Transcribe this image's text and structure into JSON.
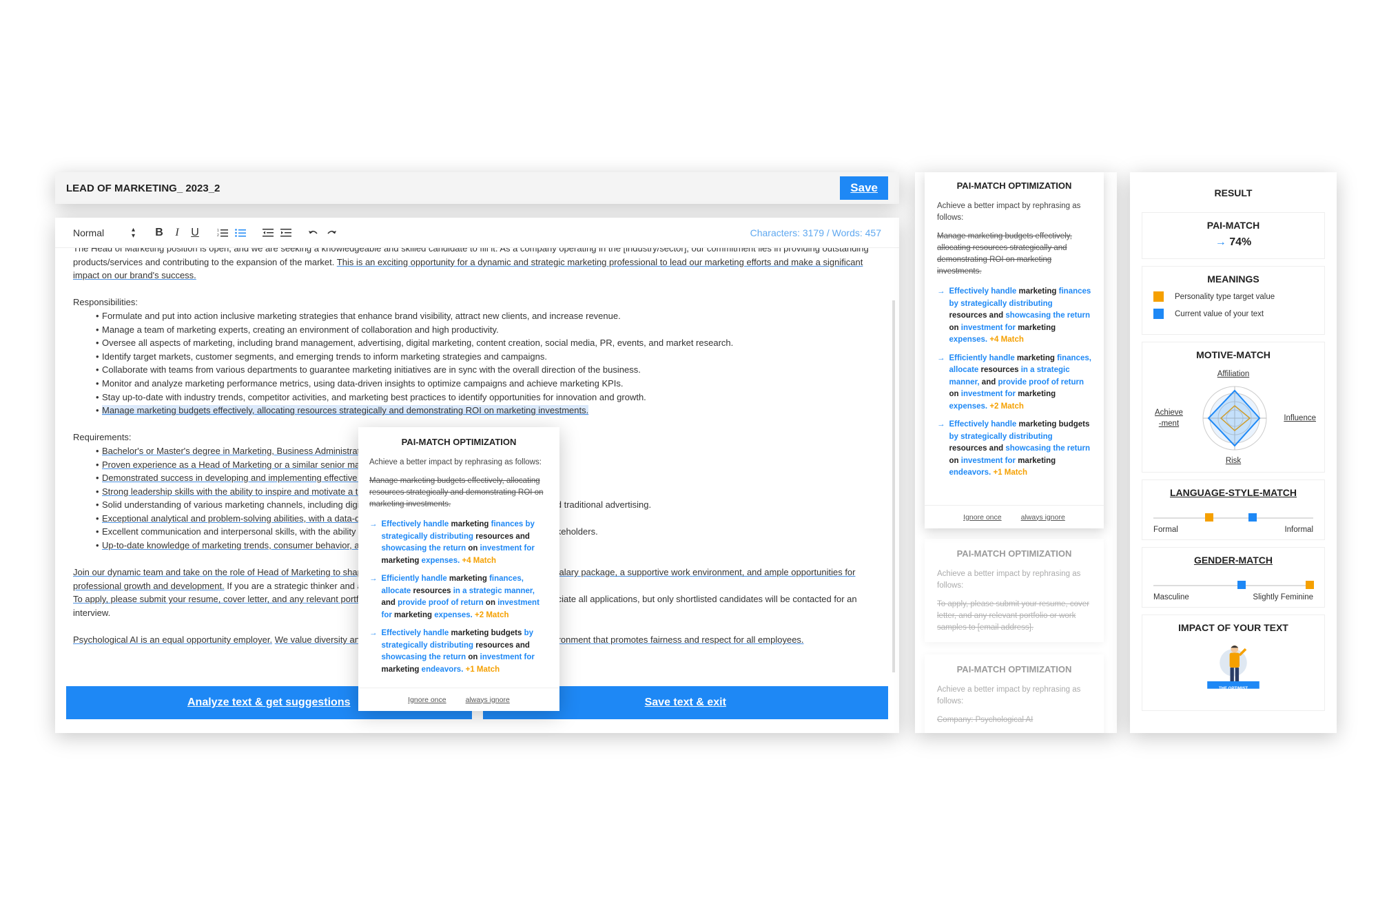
{
  "document": {
    "title": "LEAD OF MARKETING_ 2023_2",
    "save_label": "Save"
  },
  "toolbar": {
    "style": "Normal",
    "stats": "Characters: 3179 / Words: 457"
  },
  "editor": {
    "intro_1": "The Head of Marketing position is open, and we are seeking a knowledgeable and skilled candidate to fill it. As a company operating in the [industry/sector], our commitment lies in providing outstanding products/services and contributing to the expansion of the market.",
    "intro_2": "This is an exciting opportunity for a dynamic and strategic marketing professional to lead our marketing efforts and make a significant impact on our brand's success.",
    "resp_heading": "Responsibilities:",
    "responsibilities": [
      "Formulate and put into action inclusive marketing strategies that enhance brand visibility, attract new clients, and increase revenue.",
      "Manage a team of marketing experts, creating an environment of collaboration and high productivity.",
      "Oversee all aspects of marketing, including brand management, advertising, digital marketing, content creation, social media, PR, events, and market research.",
      "Identify target markets, customer segments, and emerging trends to inform marketing strategies and campaigns.",
      "Collaborate with teams from various departments to guarantee marketing initiatives are in sync with the overall direction of the business.",
      "Monitor and analyze marketing performance metrics, using data-driven insights to optimize campaigns and achieve marketing KPIs.",
      "Stay up-to-date with industry trends, competitor activities, and marketing best practices to identify opportunities for innovation and growth.",
      "Manage marketing budgets effectively, allocating resources strategically and demonstrating ROI on marketing investments."
    ],
    "req_heading": "Requirements:",
    "requirements": [
      "Bachelor's or Master's degree in Marketing, Business Administration, or a related field.",
      "Proven experience as a Head of Marketing or a similar senior marketing role.",
      "Demonstrated success in developing and implementing effective marketing strategies that drive business growth.",
      "Strong leadership skills with the ability to inspire and motivate a team to achieve common goals.",
      "Solid understanding of various marketing channels, including digital marketing, social media, content marketing, and traditional advertising.",
      "Exceptional analytical and problem-solving abilities, with a data-driven mindset.",
      "Excellent communication and interpersonal skills, with the ability to build relationships with internal and external stakeholders.",
      "Up-to-date knowledge of marketing trends, consumer behavior, and emerging technologies."
    ],
    "closing_1a": "Join our dynamic team and take on the role of Head of Marketing to shape the future of our brand. We offer a competitive salary package, a supportive work environment, and ample opportunities for professional growth and development.",
    "closing_1b": "If you are a strategic thinker and a natural leader, we would love to hear from you.",
    "closing_2a": "To apply, please submit your resume, cover letter, and any relevant portfolio or work samples to [email address].",
    "closing_2b": "We appreciate all applications, but only shortlisted candidates will be contacted for an interview.",
    "closing_3a": "Psychological AI is an equal opportunity employer.",
    "closing_3b": "We value diversity and are committed to creating an inclusive work environment that promotes fairness and respect for all employees."
  },
  "actions": {
    "analyze": "Analyze text & get suggestions",
    "save_exit": "Save text & exit"
  },
  "popup": {
    "heading": "PAI-MATCH OPTIMIZATION",
    "intro": "Achieve a better impact by rephrasing as follows:",
    "original": "Manage marketing budgets effectively, allocating resources strategically and demonstrating ROI on marketing investments.",
    "ignore_once": "Ignore once",
    "always_ignore": "always ignore"
  },
  "suggestions": [
    {
      "p1": "Effectively handle",
      "p2": " marketing ",
      "p3": "finances by strategically distributing",
      "p4": " resources and ",
      "p5": "showcasing the return",
      "p6": " on ",
      "p7": "investment for",
      "p8": " marketing ",
      "p9": "expenses.",
      "match": "+4 Match"
    },
    {
      "p1": "Efficiently handle",
      "p2": " marketing ",
      "p3": "finances, allocate",
      "p4": " resources ",
      "p5": "in a strategic manner,",
      "p6": " and ",
      "p7": "provide proof of return",
      "p8": " on ",
      "p9": "investment for",
      "p10": " marketing ",
      "p11": "expenses.",
      "match": "+2 Match"
    },
    {
      "p1": "Effectively handle",
      "p2": " marketing budgets ",
      "p3": "by strategically distributing",
      "p4": " resources and ",
      "p5": "showcasing the return",
      "p6": " on ",
      "p7": "investment for",
      "p8": " marketing ",
      "p9": "endeavors.",
      "match": "+1 Match"
    }
  ],
  "side_cards": [
    {
      "heading": "PAI-MATCH OPTIMIZATION",
      "intro": "Achieve a better impact by rephrasing as follows:",
      "original": "To apply, please submit your resume, cover letter, and any relevant portfolio or work samples to [email address]."
    },
    {
      "heading": "PAI-MATCH OPTIMIZATION",
      "intro": "Achieve a better impact by rephrasing as follows:",
      "original": "Company: Psychological AI"
    }
  ],
  "result": {
    "title": "RESULT",
    "pai_match": {
      "label": "PAI-MATCH",
      "value": "74%"
    },
    "meanings": {
      "label": "MEANINGS",
      "target": "Personality type target value",
      "current": "Current value of your text"
    },
    "motive": {
      "label": "MOTIVE-MATCH",
      "affiliation": "Affiliation",
      "achievement_1": "Achieve",
      "achievement_2": "-ment",
      "influence": "Influence",
      "risk": "Risk"
    },
    "language": {
      "label": "LANGUAGE-STYLE-MATCH",
      "left": "Formal",
      "right": "Informal",
      "target": 0.35,
      "current": 0.62
    },
    "gender": {
      "label": "GENDER-MATCH",
      "left": "Masculine",
      "right": "Slightly Feminine",
      "target": 0.98,
      "current": 0.55
    },
    "impact": {
      "label": "IMPACT OF YOUR TEXT",
      "figure_caption": "THE OPTIMIST"
    }
  },
  "colors": {
    "accent": "#1e88f5",
    "target": "#f5a000",
    "current": "#1e88f5"
  }
}
